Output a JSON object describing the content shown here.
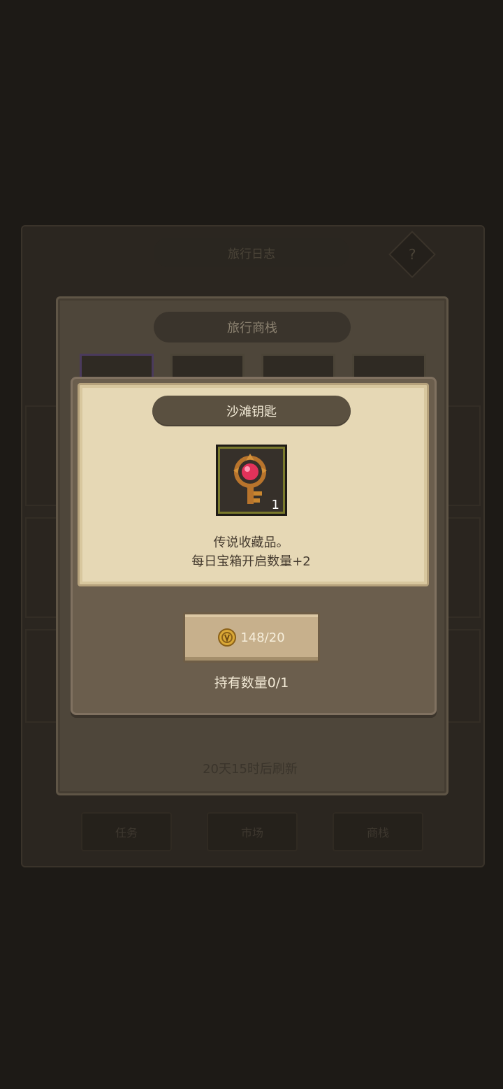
{
  "background": {
    "header_title": "旅行日志",
    "help_glyph": "?",
    "tabs": [
      "任务",
      "市场",
      "商栈"
    ]
  },
  "shop": {
    "title": "旅行商栈",
    "refresh_text": "20天15时后刷新"
  },
  "popup": {
    "title": "沙滩钥匙",
    "item": {
      "icon": "beach-key-icon",
      "count": "1"
    },
    "description_line1": "传说收藏品。",
    "description_line2": "每日宝箱开启数量+2",
    "buy_button": {
      "price": "148/20",
      "currency_icon": "gold-coin-icon"
    },
    "owned_text": "持有数量0/1"
  },
  "colors": {
    "paper": "#e6d8b5",
    "title_pill": "#5a5040",
    "gem": "#e2325a",
    "gold": "#c9962a"
  }
}
